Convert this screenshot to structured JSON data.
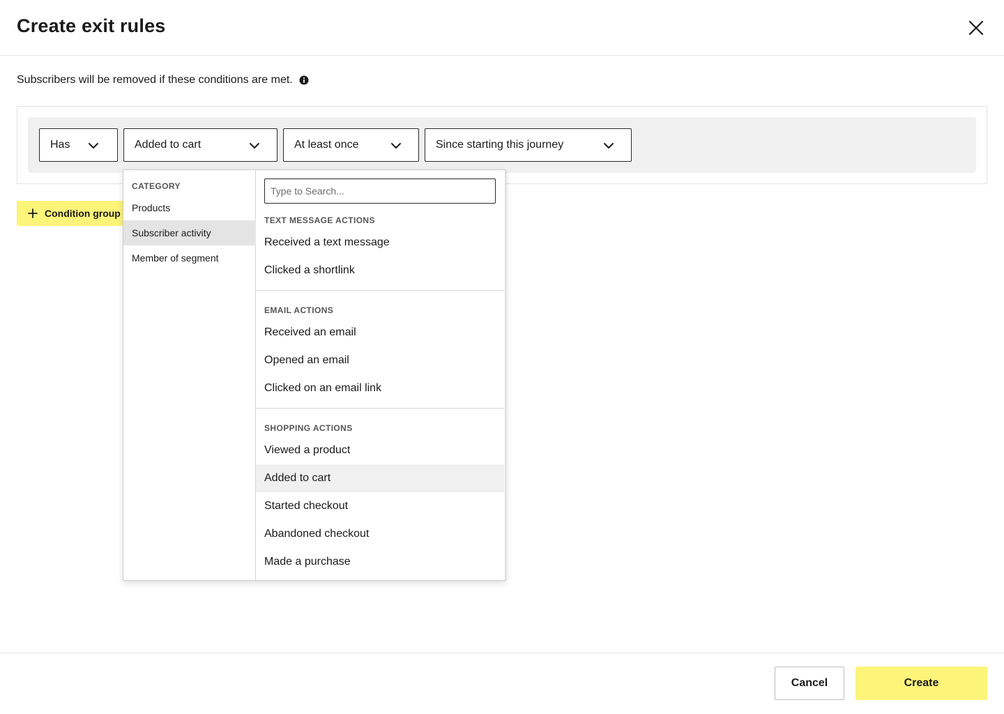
{
  "dialog": {
    "title": "Create exit rules",
    "close_icon": "close-icon"
  },
  "description": {
    "text": "Subscribers will be removed if these conditions are met.",
    "icon": "info-icon"
  },
  "condition": {
    "has": "Has",
    "event": "Added to cart",
    "frequency": "At least once",
    "timeframe": "Since starting this journey"
  },
  "condition_group_button": "Condition group",
  "dropdown": {
    "category_heading": "CATEGORY",
    "categories": [
      {
        "label": "Products",
        "active": false
      },
      {
        "label": "Subscriber activity",
        "active": true
      },
      {
        "label": "Member of segment",
        "active": false
      }
    ],
    "search_placeholder": "Type to Search...",
    "sections": [
      {
        "heading": "TEXT MESSAGE ACTIONS",
        "items": [
          "Received a text message",
          "Clicked a shortlink"
        ]
      },
      {
        "heading": "EMAIL ACTIONS",
        "items": [
          "Received an email",
          "Opened an email",
          "Clicked on an email link"
        ]
      },
      {
        "heading": "SHOPPING ACTIONS",
        "items": [
          "Viewed a product",
          "Added to cart",
          "Started checkout",
          "Abandoned checkout",
          "Made a purchase"
        ]
      }
    ],
    "selected_item": "Added to cart"
  },
  "footer": {
    "cancel": "Cancel",
    "create": "Create"
  },
  "colors": {
    "accent": "#fdf47a",
    "panel": "#eff0ef",
    "text": "#1a1a1a"
  }
}
